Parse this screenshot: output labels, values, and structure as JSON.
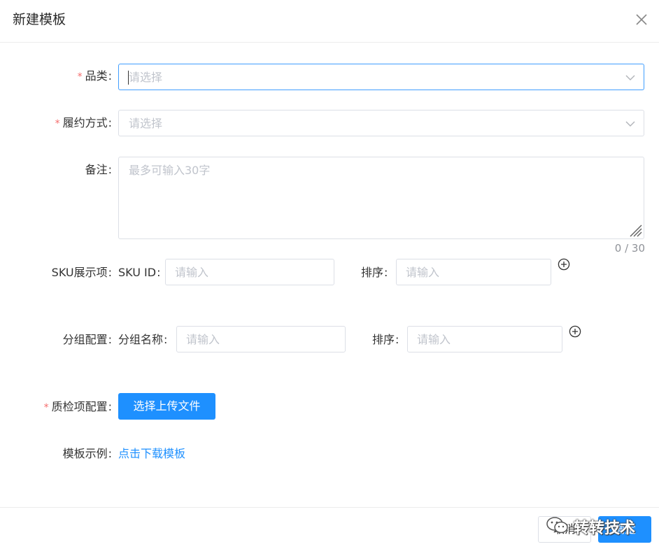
{
  "dialog": {
    "title": "新建模板"
  },
  "form": {
    "category": {
      "required": "*",
      "label": "品类",
      "placeholder": "请选择"
    },
    "fulfillment": {
      "required": "*",
      "label": "履约方式",
      "placeholder": "请选择"
    },
    "remark": {
      "label": "备注",
      "placeholder": "最多可输入30字",
      "counter": "0 / 30"
    },
    "sku": {
      "label": "SKU展示项",
      "id_label": "SKU ID",
      "id_placeholder": "请输入",
      "sort_label": "排序",
      "sort_placeholder": "请输入"
    },
    "group": {
      "label": "分组配置",
      "name_label": "分组名称",
      "name_placeholder": "请输入",
      "sort_label": "排序",
      "sort_placeholder": "请输入"
    },
    "qc": {
      "required": "*",
      "label": "质检项配置",
      "button": "选择上传文件"
    },
    "example": {
      "label": "模板示例",
      "link": "点击下载模板"
    },
    "colon": ":"
  },
  "footer": {
    "cancel": "取消",
    "ok": "确定"
  },
  "watermark": {
    "text": "转转技术",
    "icon": "wechat-icon"
  },
  "colors": {
    "primary": "#1e90ff",
    "required": "#f56c6c",
    "focus_border": "#409eff"
  }
}
